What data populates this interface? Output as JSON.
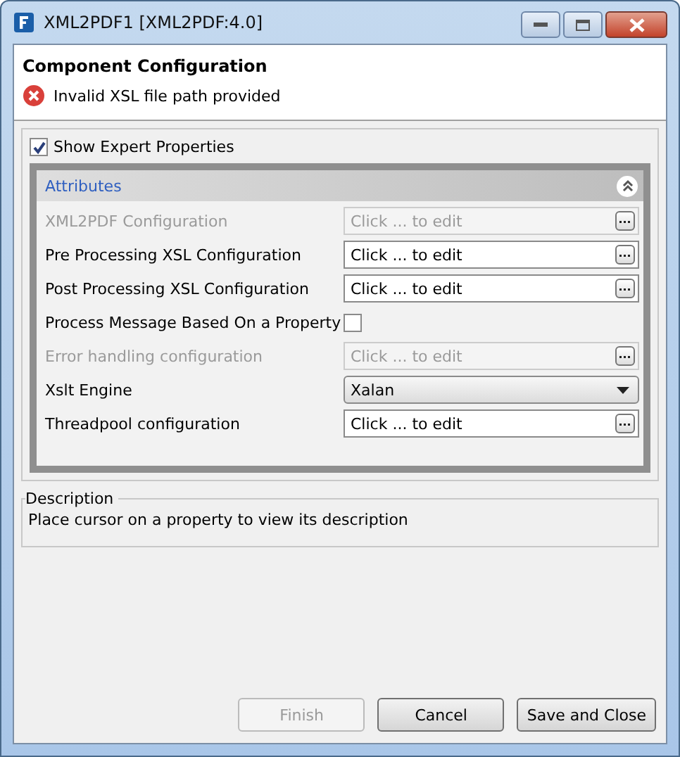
{
  "window": {
    "title": "XML2PDF1 [XML2PDF:4.0]"
  },
  "header": {
    "title": "Component Configuration",
    "error": "Invalid XSL file path provided"
  },
  "expert": {
    "label": "Show Expert Properties",
    "checked": true
  },
  "attributes": {
    "title": "Attributes",
    "expanded": true,
    "rows": [
      {
        "kind": "edit",
        "label": "XML2PDF Configuration",
        "value": "Click ... to edit",
        "disabled": true
      },
      {
        "kind": "edit",
        "label": "Pre Processing XSL Configuration",
        "value": "Click ... to edit",
        "disabled": false
      },
      {
        "kind": "edit",
        "label": "Post Processing XSL Configuration",
        "value": "Click ... to edit",
        "disabled": false
      },
      {
        "kind": "check",
        "label": "Process Message Based On a Property",
        "checked": false,
        "disabled": false
      },
      {
        "kind": "edit",
        "label": "Error handling configuration",
        "value": "Click ... to edit",
        "disabled": true
      },
      {
        "kind": "select",
        "label": "Xslt Engine",
        "value": "Xalan",
        "disabled": false
      },
      {
        "kind": "edit",
        "label": "Threadpool configuration",
        "value": "Click ... to edit",
        "disabled": false
      }
    ]
  },
  "description": {
    "title": "Description",
    "text": "Place cursor on a property to view its description"
  },
  "buttons": [
    {
      "label": "Finish",
      "disabled": true
    },
    {
      "label": "Cancel",
      "disabled": false
    },
    {
      "label": "Save and Close",
      "disabled": false
    }
  ]
}
